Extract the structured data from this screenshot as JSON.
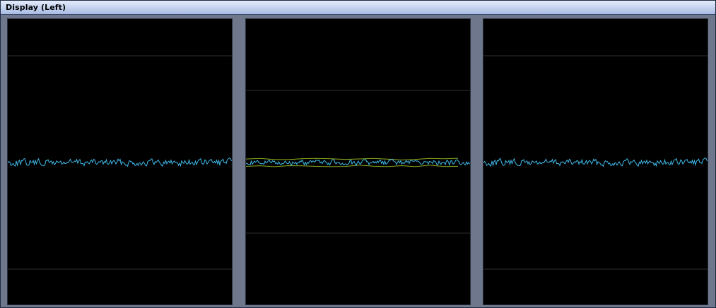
{
  "window": {
    "title": "Display (Left)"
  },
  "colors": {
    "frame": "#6e778c",
    "plot_background": "#000000",
    "gridline": "#2e2e2e",
    "trace": "#3fb8e8",
    "envelope": "#8fae1e"
  },
  "panels": [
    {
      "name": "left",
      "gridlines": 2,
      "envelope": false
    },
    {
      "name": "center",
      "gridlines": 2,
      "envelope": true
    },
    {
      "name": "right",
      "gridlines": 2,
      "envelope": false
    }
  ]
}
